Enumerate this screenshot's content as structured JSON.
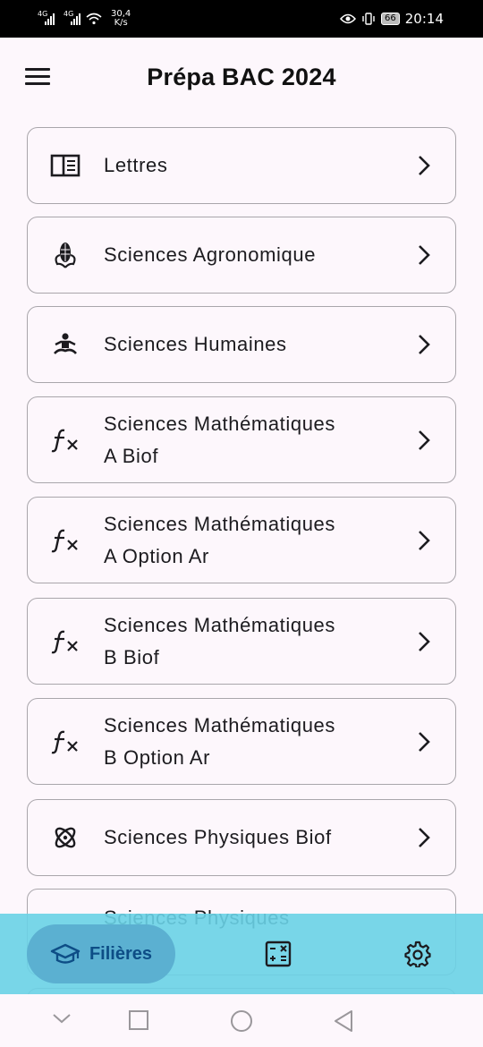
{
  "status_bar": {
    "signal1_label": "4G",
    "signal2_label": "4G",
    "speed_value": "30,4",
    "speed_unit": "K/s",
    "battery": "66",
    "time": "20:14"
  },
  "app_bar": {
    "title": "Prépa BAC 2024",
    "menu_icon": "menu-icon"
  },
  "filieres": [
    {
      "label": "Lettres",
      "icon": "book-icon"
    },
    {
      "label": "Sciences Agronomique",
      "icon": "corn-icon"
    },
    {
      "label": "Sciences Humaines",
      "icon": "meditation-icon"
    },
    {
      "label": "Sciences Mathématiques\nA Biof",
      "icon": "function-icon"
    },
    {
      "label": "Sciences Mathématiques\nA Option Ar",
      "icon": "function-icon"
    },
    {
      "label": "Sciences Mathématiques\nB Biof",
      "icon": "function-icon"
    },
    {
      "label": "Sciences Mathématiques\nB Option Ar",
      "icon": "function-icon"
    },
    {
      "label": "Sciences Physiques Biof",
      "icon": "atom-icon"
    },
    {
      "label": "Sciences Physiques",
      "icon": "atom-icon"
    }
  ],
  "bottom_nav": {
    "active_label": "Filières",
    "items": [
      "graduation-cap-icon",
      "calculator-icon",
      "gear-icon"
    ]
  },
  "colors": {
    "background": "#fdf7fc",
    "bottom_nav": "#69d2e6",
    "active_pill": "#5bb0d1",
    "active_text": "#0d4d86",
    "border": "#a9a6ab"
  }
}
